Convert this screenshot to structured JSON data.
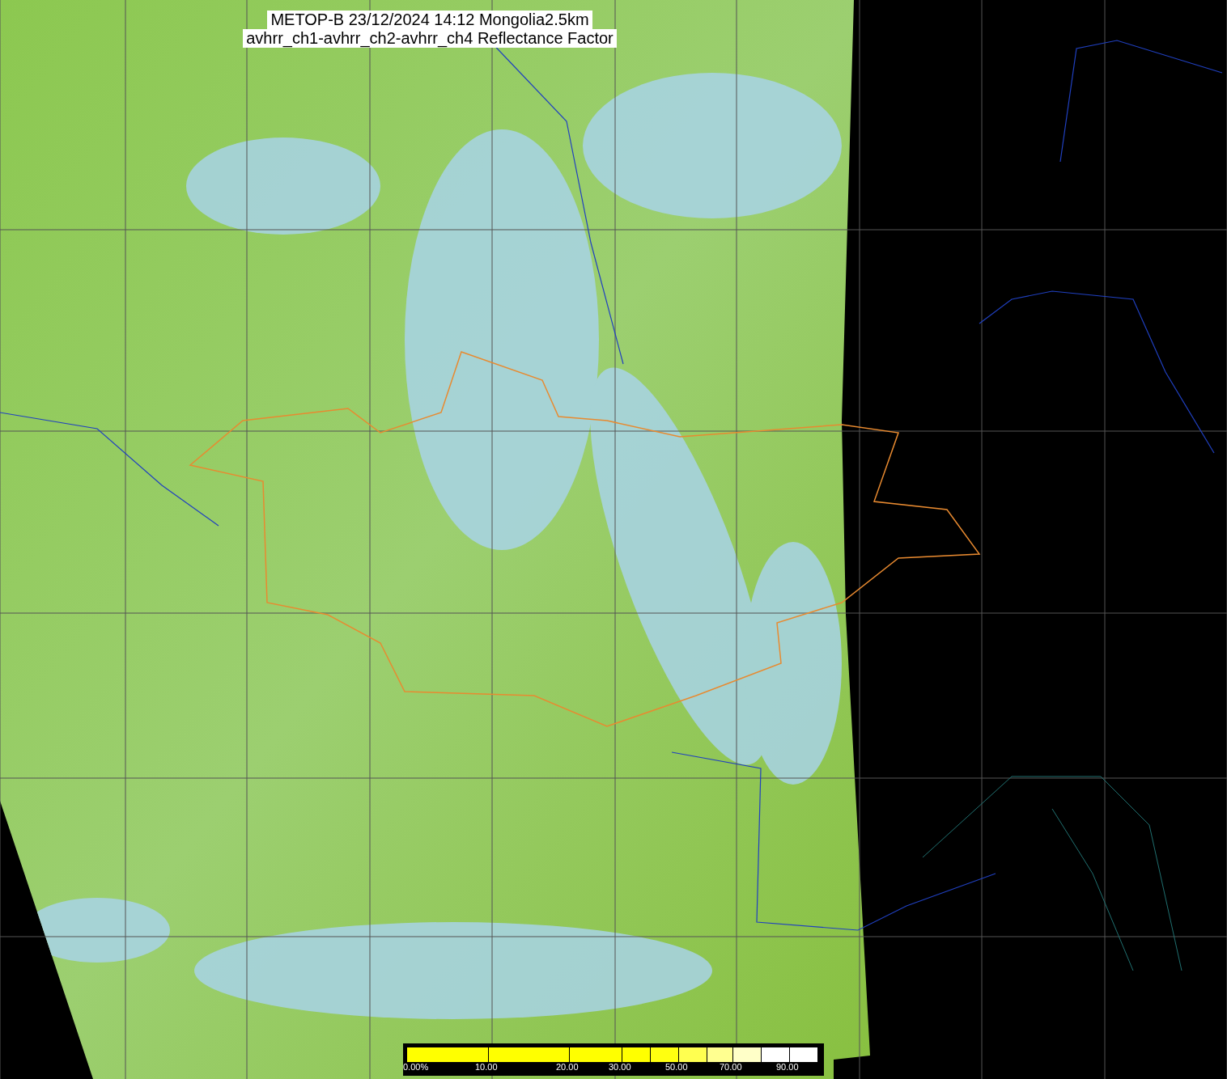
{
  "title": {
    "line_1": "METOP-B 23/12/2024 14:12 Mongolia2.5km",
    "line_2": "avhrr_ch1-avhrr_ch2-avhrr_ch4 Reflectance Factor"
  },
  "legend": {
    "segments": [
      {
        "color": "#ffff00",
        "label": "0.00%"
      },
      {
        "color": "#ffff00",
        "label": "10.00"
      },
      {
        "color": "#ffff00",
        "label": "20.00"
      },
      {
        "color": "#ffff00",
        "label": "30.00"
      },
      {
        "color": "#ffff10"
      },
      {
        "color": "#ffff50",
        "label": "50.00"
      },
      {
        "color": "#ffff90"
      },
      {
        "color": "#ffffc8",
        "label": "70.00"
      },
      {
        "color": "#ffffff"
      },
      {
        "color": "#ffffff",
        "label": "90.00"
      }
    ]
  }
}
